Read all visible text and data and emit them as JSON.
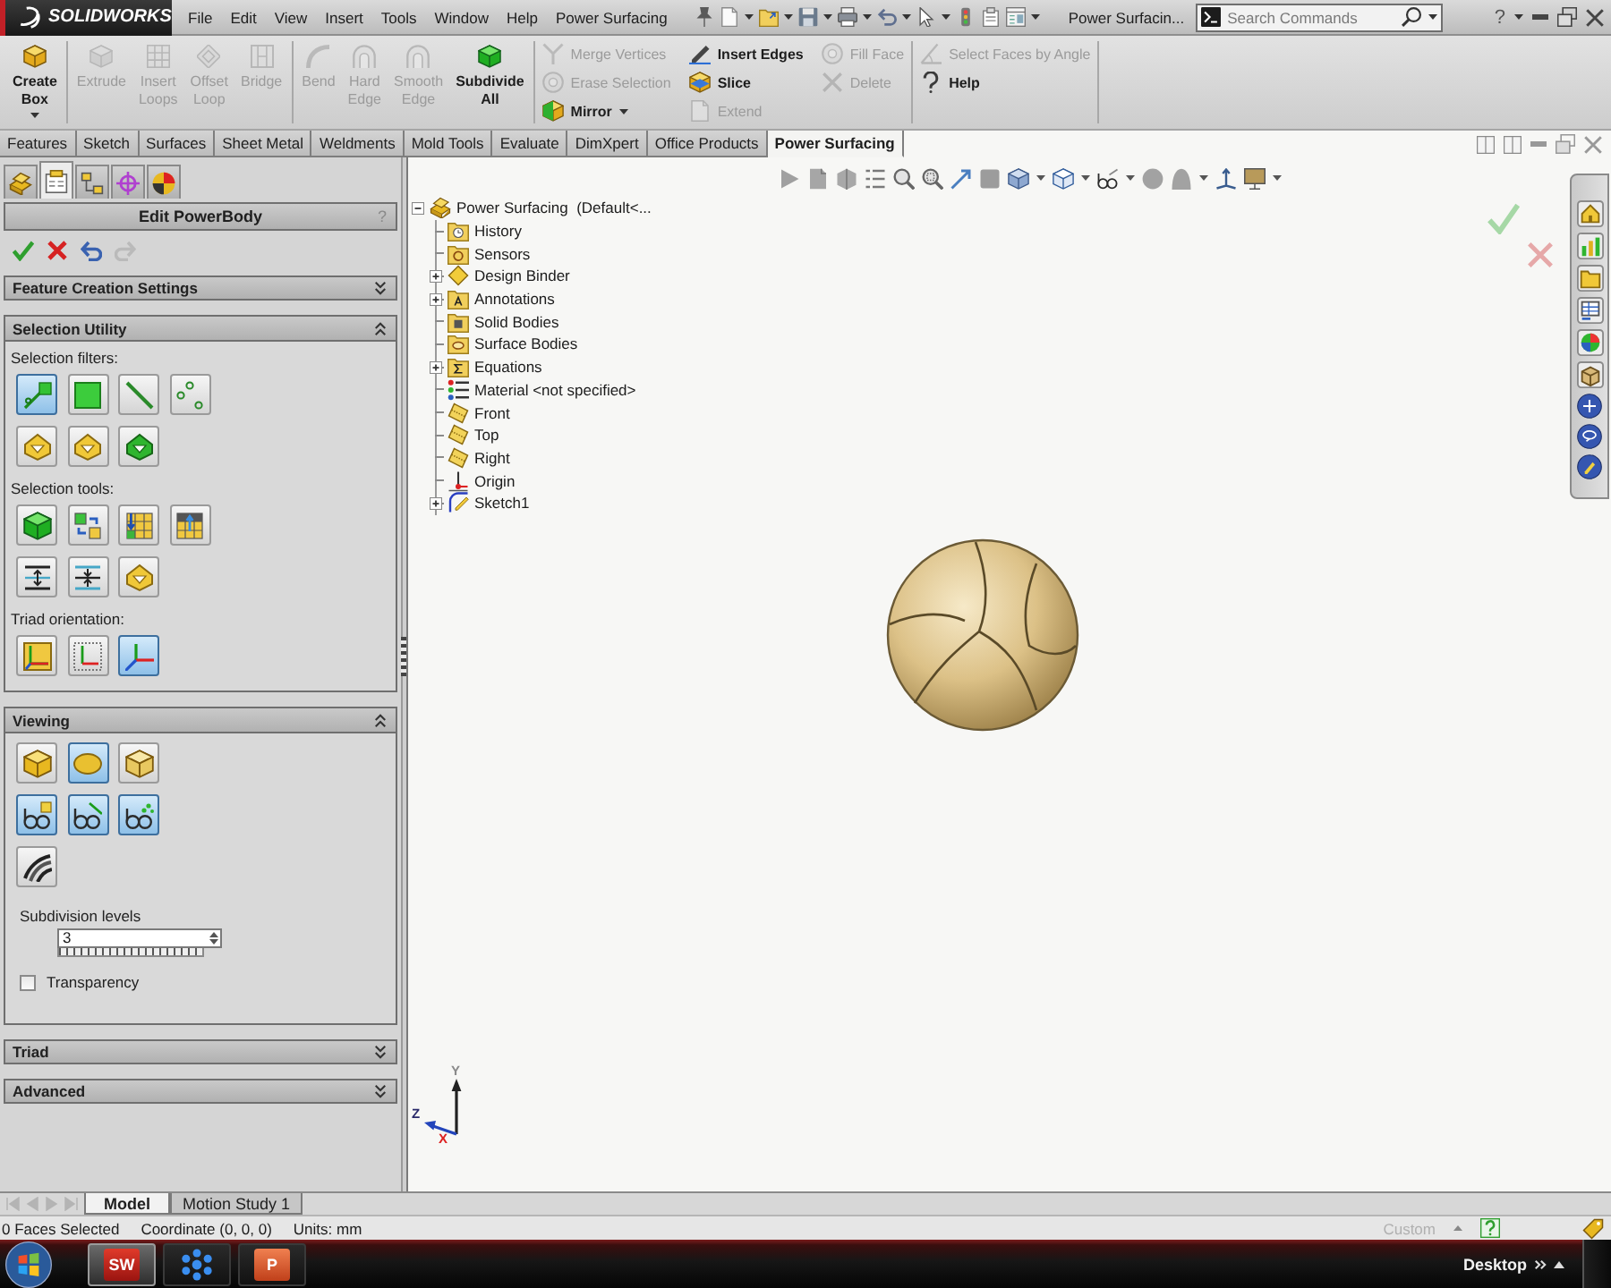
{
  "title_bar": {
    "logo": "SOLIDWORKS",
    "menus": [
      "File",
      "Edit",
      "View",
      "Insert",
      "Tools",
      "Window",
      "Help",
      "Power Surfacing"
    ],
    "document_title": "Power Surfacin...",
    "search": {
      "placeholder": "Search Commands"
    },
    "help": "?"
  },
  "ribbon": [
    {
      "kind": "large",
      "items": [
        {
          "label": "Create Box",
          "disabled": false,
          "dropdown": true
        }
      ]
    },
    {
      "kind": "large",
      "items": [
        {
          "label": "Extrude",
          "disabled": true,
          "dropdown": false
        },
        {
          "label": "Insert Loops",
          "disabled": true,
          "dropdown": false
        },
        {
          "label": "Offset Loop",
          "disabled": true,
          "dropdown": false
        },
        {
          "label": "Bridge",
          "disabled": true,
          "dropdown": false
        }
      ]
    },
    {
      "kind": "large",
      "items": [
        {
          "label": "Bend",
          "disabled": true,
          "dropdown": false
        },
        {
          "label": "Hard Edge",
          "disabled": true,
          "dropdown": false
        },
        {
          "label": "Smooth Edge",
          "disabled": true,
          "dropdown": false
        },
        {
          "label": "Subdivide All",
          "disabled": false,
          "dropdown": false
        }
      ]
    },
    {
      "kind": "small",
      "columns": [
        [
          {
            "label": "Merge Vertices",
            "disabled": true,
            "dropdown": false
          },
          {
            "label": "Erase Selection",
            "disabled": true,
            "dropdown": false
          },
          {
            "label": "Mirror",
            "disabled": false,
            "dropdown": true
          }
        ],
        [
          {
            "label": "Insert Edges",
            "disabled": false,
            "dropdown": false
          },
          {
            "label": "Slice",
            "disabled": false,
            "dropdown": false
          },
          {
            "label": "Extend",
            "disabled": true,
            "dropdown": false
          }
        ],
        [
          {
            "label": "Fill Face",
            "disabled": true,
            "dropdown": false
          },
          {
            "label": "Delete",
            "disabled": true,
            "dropdown": false
          }
        ]
      ]
    },
    {
      "kind": "small",
      "columns": [
        [
          {
            "label": "Select Faces by Angle",
            "disabled": true,
            "dropdown": false
          },
          {
            "label": "Help",
            "disabled": false,
            "dropdown": false
          }
        ]
      ]
    }
  ],
  "command_tabs": [
    {
      "label": "Features",
      "selected": false
    },
    {
      "label": "Sketch",
      "selected": false
    },
    {
      "label": "Surfaces",
      "selected": false
    },
    {
      "label": "Sheet Metal",
      "selected": false
    },
    {
      "label": "Weldments",
      "selected": false
    },
    {
      "label": "Mold Tools",
      "selected": false
    },
    {
      "label": "Evaluate",
      "selected": false
    },
    {
      "label": "DimXpert",
      "selected": false
    },
    {
      "label": "Office Products",
      "selected": false
    },
    {
      "label": "Power Surfacing",
      "selected": true
    }
  ],
  "property_manager": {
    "tabs": [
      {
        "selected": false
      },
      {
        "selected": true
      },
      {
        "selected": false
      },
      {
        "selected": false
      },
      {
        "selected": false
      }
    ],
    "title": "Edit PowerBody",
    "help": "?",
    "actions": [
      {
        "kind": "ok",
        "disabled": false
      },
      {
        "kind": "cancel",
        "disabled": false
      },
      {
        "kind": "undo",
        "disabled": false
      },
      {
        "kind": "redo",
        "disabled": true
      }
    ],
    "sections": [
      {
        "title": "Feature Creation Settings",
        "expanded": false
      },
      {
        "title": "Selection Utility",
        "expanded": true,
        "groups": [
          {
            "label": "Selection filters:",
            "rows": [
              [
                {
                  "selected": true
                },
                {
                  "selected": false
                },
                {
                  "selected": false
                },
                {
                  "selected": false
                }
              ],
              [
                {
                  "selected": false
                },
                {
                  "selected": false
                },
                {
                  "selected": false
                }
              ]
            ]
          },
          {
            "label": "Selection tools:",
            "rows": [
              [
                {
                  "selected": false
                },
                {
                  "selected": false
                },
                {
                  "selected": false
                },
                {
                  "selected": false
                }
              ],
              [
                {
                  "selected": false
                },
                {
                  "selected": false
                },
                {
                  "selected": false
                }
              ]
            ]
          },
          {
            "label": "Triad orientation:",
            "rows": [
              [
                {
                  "selected": false
                },
                {
                  "selected": false
                },
                {
                  "selected": true
                }
              ]
            ]
          }
        ]
      },
      {
        "title": "Viewing",
        "expanded": true,
        "groups": [
          {
            "rows": [
              [
                {
                  "selected": false
                },
                {
                  "selected": true
                },
                {
                  "selected": false
                }
              ],
              [
                {
                  "selected": true
                },
                {
                  "selected": true
                },
                {
                  "selected": true
                }
              ],
              [
                {
                  "selected": false
                }
              ]
            ]
          }
        ],
        "subdivision": {
          "label": "Subdivision levels",
          "value": "3"
        },
        "transparency": {
          "label": "Transparency",
          "checked": false
        }
      },
      {
        "title": "Triad",
        "expanded": false
      },
      {
        "title": "Advanced",
        "expanded": false
      }
    ]
  },
  "feature_tree": [
    {
      "label": "Power Surfacing  (Default<...",
      "kind": "part",
      "expanded": true,
      "children": [
        {
          "label": "History",
          "kind": "history"
        },
        {
          "label": "Sensors",
          "kind": "sensors"
        },
        {
          "label": "Design Binder",
          "kind": "binder",
          "expanded": false
        },
        {
          "label": "Annotations",
          "kind": "annotations",
          "expanded": false
        },
        {
          "label": "Solid Bodies",
          "kind": "solid"
        },
        {
          "label": "Surface Bodies",
          "kind": "surface"
        },
        {
          "label": "Equations",
          "kind": "equations",
          "expanded": false
        },
        {
          "label": "Material <not specified>",
          "kind": "material"
        },
        {
          "label": "Front",
          "kind": "plane"
        },
        {
          "label": "Top",
          "kind": "plane"
        },
        {
          "label": "Right",
          "kind": "plane"
        },
        {
          "label": "Origin",
          "kind": "origin"
        },
        {
          "label": "Sketch1",
          "kind": "sketch",
          "expanded": false
        }
      ]
    }
  ],
  "triad": {
    "labels": [
      "Y",
      "Z",
      "X"
    ]
  },
  "model_tabs": [
    {
      "label": "Model",
      "selected": true
    },
    {
      "label": "Motion Study 1",
      "selected": false
    }
  ],
  "status_bar": {
    "items": [
      "0 Faces Selected",
      "Coordinate (0, 0, 0)",
      "Units: mm"
    ],
    "unit_system": "Custom"
  },
  "taskbar": {
    "apps": [
      {
        "kind": "sw",
        "label": "SW",
        "selected": true
      },
      {
        "kind": "flake",
        "selected": false
      },
      {
        "kind": "slides",
        "label": "P",
        "selected": false
      }
    ],
    "desktop": "Desktop"
  }
}
